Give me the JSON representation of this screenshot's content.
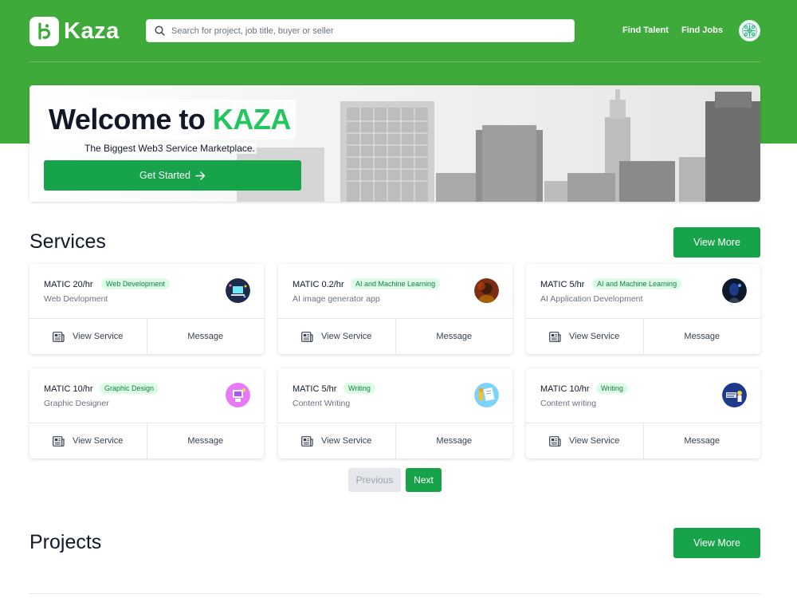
{
  "nav": {
    "brand": "Kaza",
    "search_placeholder": "Search for project, job title, buyer or seller",
    "find_talent": "Find Talent",
    "find_jobs": "Find Jobs"
  },
  "hero": {
    "title_prefix": "Welcome to ",
    "title_accent": "KAZA",
    "subtitle": "The Biggest Web3 Service Marketplace.",
    "cta": "Get Started"
  },
  "services": {
    "title": "Services",
    "view_more": "View More",
    "items": [
      {
        "price": "MATIC 20/hr",
        "tag": "Web Development",
        "name": "Web Devlopment",
        "view": "View Service",
        "message": "Message"
      },
      {
        "price": "MATIC 0.2/hr",
        "tag": "AI and Machine Learning",
        "name": "AI image generator app",
        "view": "View Service",
        "message": "Message"
      },
      {
        "price": "MATIC 5/hr",
        "tag": "AI and Machine Learning",
        "name": "AI Application Development",
        "view": "View Service",
        "message": "Message"
      },
      {
        "price": "MATIC 10/hr",
        "tag": "Graphic Design",
        "name": "Graphic Designer",
        "view": "View Service",
        "message": "Message"
      },
      {
        "price": "MATIC 5/hr",
        "tag": "Writing",
        "name": "Content Writing",
        "view": "View Service",
        "message": "Message"
      },
      {
        "price": "MATIC 10/hr",
        "tag": "Writing",
        "name": "Content writing",
        "view": "View Service",
        "message": "Message"
      }
    ]
  },
  "pagination": {
    "previous": "Previous",
    "next": "Next"
  },
  "projects": {
    "title": "Projects",
    "view_more": "View More"
  },
  "colors": {
    "brand_green": "#3eaa3a",
    "button_green": "#16a34a",
    "accent": "#22c55e",
    "tag_bg": "#dcfce7"
  }
}
